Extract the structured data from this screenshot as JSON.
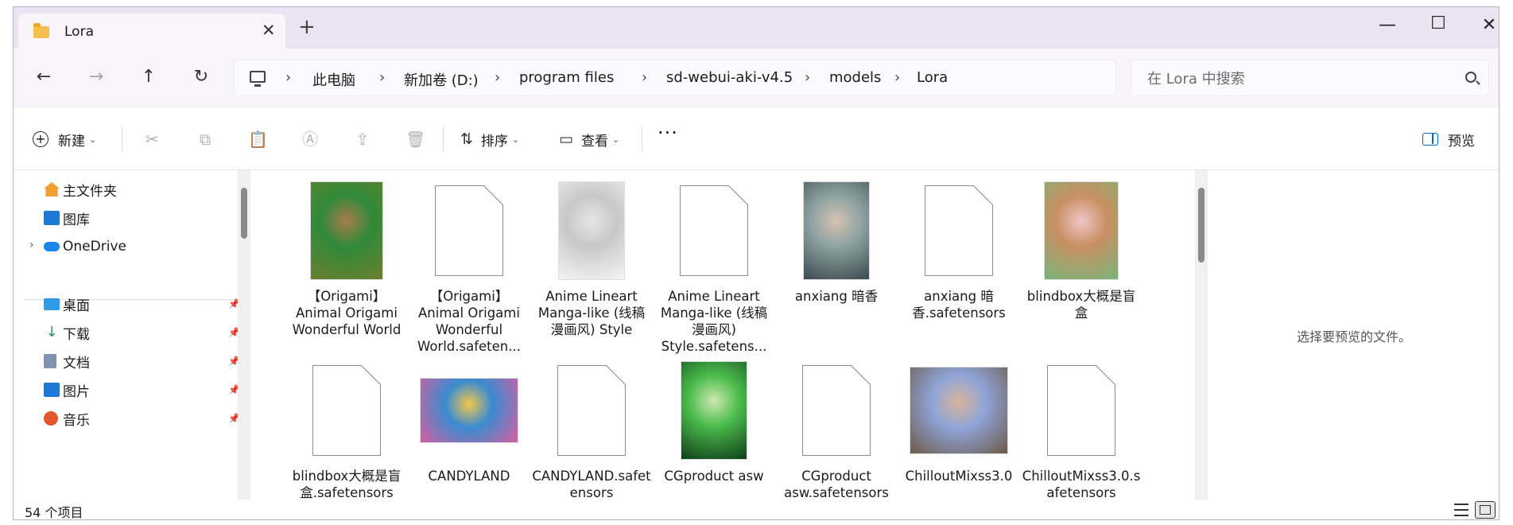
{
  "tab": {
    "title": "Lora",
    "close": "✕",
    "new_tab": "+"
  },
  "window_buttons": {
    "minimize": "—",
    "maximize": "☐",
    "close": "✕"
  },
  "nav": {
    "back": "←",
    "forward": "→",
    "up": "↑",
    "refresh": "↻"
  },
  "breadcrumb": {
    "sep": "›",
    "items": [
      "此电脑",
      "新加卷 (D:)",
      "program files",
      "sd-webui-aki-v4.5",
      "models",
      "Lora"
    ]
  },
  "search": {
    "placeholder": "在 Lora 中搜索"
  },
  "toolbar": {
    "new_label": "新建",
    "sort_label": "排序",
    "view_label": "查看",
    "more": "···",
    "preview_label": "预览"
  },
  "sidebar": {
    "top": [
      {
        "label": "主文件夹",
        "color": "#f0a030"
      },
      {
        "label": "图库",
        "color": "#1e79d6"
      },
      {
        "label": "OneDrive",
        "color": "#1a86e8"
      }
    ],
    "quick": [
      {
        "label": "桌面",
        "color": "#2e9be8"
      },
      {
        "label": "下载",
        "color": "#1e9a5b"
      },
      {
        "label": "文档",
        "color": "#8193b0"
      },
      {
        "label": "图片",
        "color": "#1e79d6"
      },
      {
        "label": "音乐",
        "color": "#e2572c"
      }
    ],
    "expand_glyph": "›",
    "pin_glyph": "📌"
  },
  "files": [
    {
      "name": "【Origami】Animal Origami Wonderful World",
      "kind": "image",
      "colors": [
        "#6b7f2e",
        "#2f8a3a",
        "#a97b4a"
      ]
    },
    {
      "name": "【Origami】Animal Origami Wonderful World.safeten...",
      "kind": "doc"
    },
    {
      "name": "Anime Lineart Manga-like (线稿漫画风) Style",
      "kind": "image",
      "colors": [
        "#f4f4f4",
        "#c8c8c8",
        "#e6e6e6"
      ]
    },
    {
      "name": "Anime Lineart Manga-like (线稿漫画风) Style.safetens...",
      "kind": "doc"
    },
    {
      "name": "anxiang  暗香",
      "kind": "image",
      "colors": [
        "#3c4a4f",
        "#8fa3a4",
        "#d7c2b0"
      ]
    },
    {
      "name": "anxiang  暗香.safetensors",
      "kind": "doc"
    },
    {
      "name": "blindbox大概是盲盒",
      "kind": "image",
      "colors": [
        "#7ab57a",
        "#c88f62",
        "#f0c6c6"
      ]
    },
    {
      "name": "blindbox大概是盲盒.safetensors",
      "kind": "doc"
    },
    {
      "name": "CANDYLAND",
      "kind": "image",
      "colors": [
        "#d65fa0",
        "#3b8bd0",
        "#f2c84b"
      ]
    },
    {
      "name": "CANDYLAND.safetensors",
      "kind": "doc"
    },
    {
      "name": "CGproduct asw",
      "kind": "image",
      "colors": [
        "#0f3e1a",
        "#4cbc4c",
        "#cfe9b2"
      ]
    },
    {
      "name": "CGproduct asw.safetensors",
      "kind": "doc"
    },
    {
      "name": "ChilloutMixss3.0",
      "kind": "image",
      "colors": [
        "#6d5a48",
        "#8fa4d8",
        "#d9b59a"
      ]
    },
    {
      "name": "ChilloutMixss3.0.safetensors",
      "kind": "doc"
    }
  ],
  "preview": {
    "empty_text": "选择要预览的文件。"
  },
  "status": {
    "count": "54 个项目"
  }
}
